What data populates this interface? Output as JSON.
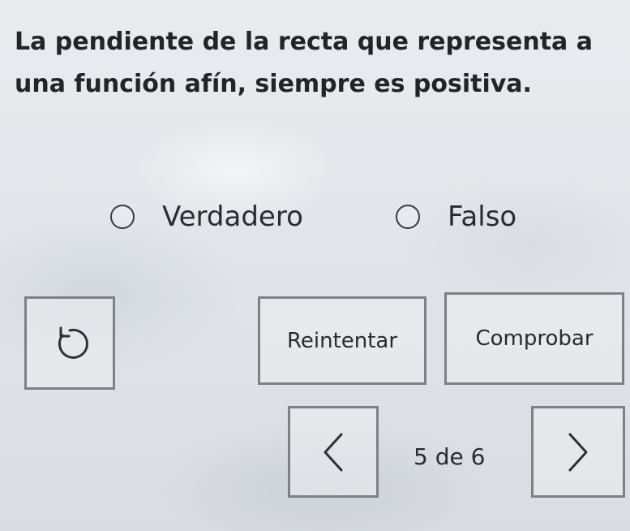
{
  "question": {
    "text": "La pendiente de la recta que representa a una función afín, siempre es positiva."
  },
  "options": [
    {
      "label": "Verdadero",
      "selected": false
    },
    {
      "label": "Falso",
      "selected": false
    }
  ],
  "actions": {
    "undo_icon": "undo-icon",
    "retry_label": "Reintentar",
    "check_label": "Comprobar"
  },
  "pagination": {
    "prev_icon": "chevron-left-icon",
    "indicator": "5 de 6",
    "next_icon": "chevron-right-icon"
  }
}
